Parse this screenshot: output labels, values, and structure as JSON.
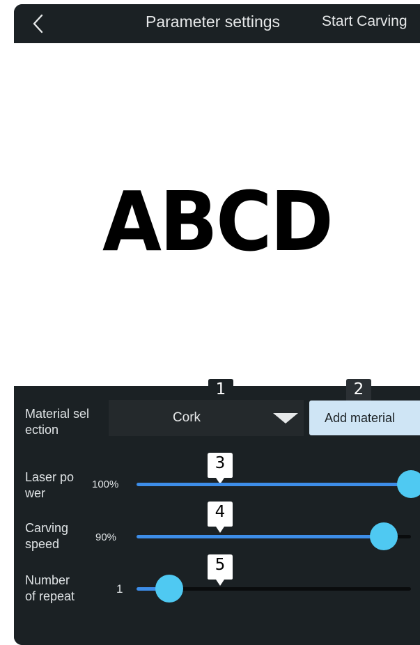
{
  "header": {
    "back_icon": "chevron-left-icon",
    "title": "Parameter settings",
    "start_label": "Start Carving"
  },
  "canvas": {
    "preview_text": "ABCD"
  },
  "material": {
    "label_line1": "Material sel",
    "label_line2": "ection",
    "selected": "Cork",
    "dropdown_icon": "triangle-down-icon",
    "add_button": "Add material"
  },
  "laser_power": {
    "label_line1": "Laser po",
    "label_line2": "wer",
    "value_text": "100%",
    "level": 1.0
  },
  "carving_speed": {
    "label_line1": "Carving",
    "label_line2": "speed",
    "value_text": "90%",
    "level": 0.9
  },
  "repeat": {
    "label_line1": "Number",
    "label_line2": "of repeat",
    "value_text": "1",
    "level": 0.12
  },
  "markers": [
    "1",
    "2",
    "3",
    "4",
    "5"
  ],
  "colors": {
    "background": "#1b2124",
    "accent_track": "#3d8de8",
    "thumb": "#4fc9f2",
    "add_button": "#cfe5f5"
  }
}
